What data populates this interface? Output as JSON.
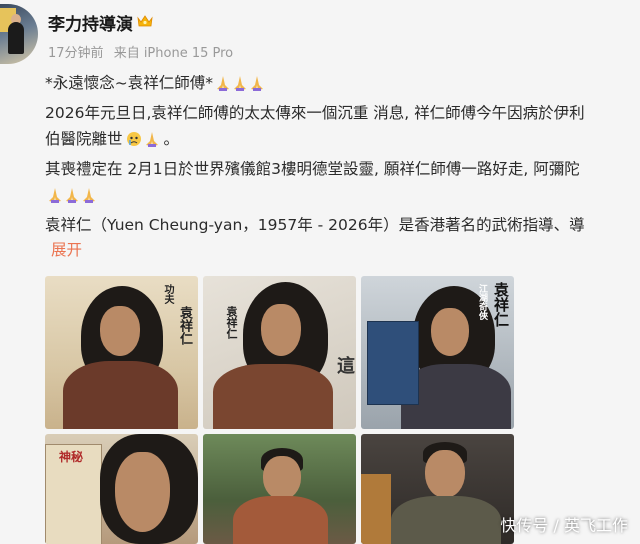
{
  "author": {
    "name": "李力持導演",
    "time": "17分钟前",
    "source": "来自 iPhone 15 Pro"
  },
  "post": {
    "lines": [
      "*永遠懷念~袁祥仁師傅*",
      "2026年元旦日,袁祥仁師傅的太太傳來一個沉重 消息, 祥仁師傅今午因病於伊利",
      "伯醫院離世",
      "其喪禮定在 2月1日於世界殯儀館3樓明德堂設靈, 願祥仁師傅一路好走, 阿彌陀",
      "",
      "袁祥仁（Yuen Cheung-yan，1957年 - 2026年）是香港著名的武術指導、導"
    ],
    "expand": "展开"
  },
  "photos": {
    "p1_caption": "袁祥仁",
    "p1_tag": "功夫",
    "p2_caption": "袁祥仁",
    "p2_tag": "這",
    "p3_caption": "袁祥仁",
    "p3_tag": "江湖奇俠",
    "p4_tag": "神秘"
  },
  "watermark": "快传号 / 英飞工作",
  "colors": {
    "accent": "#eb7350",
    "text": "#2b2b2b",
    "meta": "#999999"
  }
}
